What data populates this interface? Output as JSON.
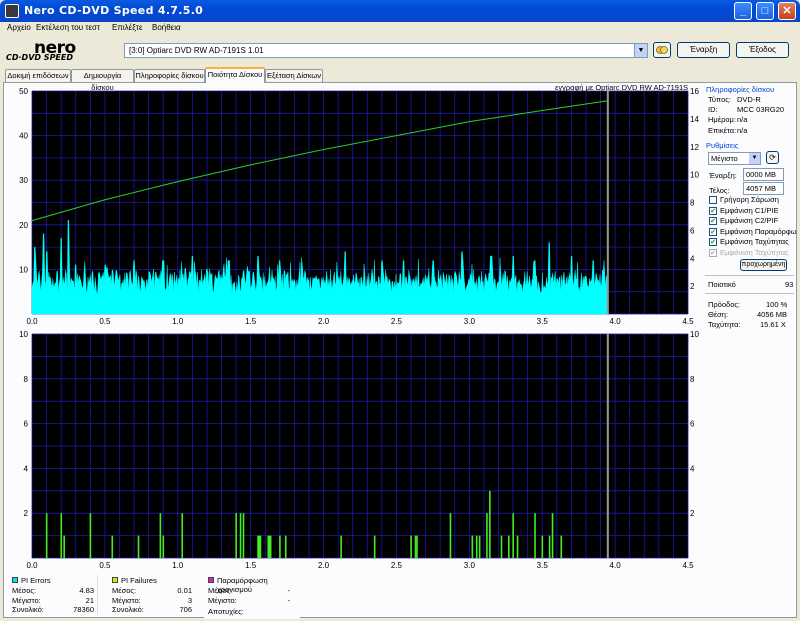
{
  "window": {
    "title": "Nero CD-DVD Speed 4.7.5.0",
    "minimize_symbol": "_",
    "maximize_symbol": "□",
    "close_symbol": "✕"
  },
  "menu": [
    "Αρχείο",
    "Εκτέλεση του τεστ",
    "Επιλέξτε",
    "Βοήθεια"
  ],
  "logo": {
    "brand": "nero",
    "product": "CD·DVD SPEED"
  },
  "drive": {
    "selected": "[3:0]   Optiarc DVD RW AD-7191S 1.01"
  },
  "toolbar": {
    "start_label": "Έναρξη",
    "exit_label": "Έξοδος"
  },
  "tabs": [
    {
      "label": "Δοκιμή επιδόσεων",
      "active": false
    },
    {
      "label": "Δημιουργία δίσκου",
      "active": false
    },
    {
      "label": "Πληροφορίες δίσκου",
      "active": false
    },
    {
      "label": "Ποιότητα Δίσκου",
      "active": true
    },
    {
      "label": "Εξέταση Δίσκων",
      "active": false
    }
  ],
  "top_chart_caption": "εγγραφή με Optiarc  DVD RW AD-7191S",
  "disc_info": {
    "title": "Πληροφορίες δίσκου",
    "type_label": "Τύπος:",
    "type_value": "DVD-R",
    "id_label": "ID:",
    "id_value": "MCC 03RG20",
    "date_label": "Ημέρομ:",
    "date_value": "n/a",
    "label_label": "Επικέτα:",
    "label_value": "n/a"
  },
  "settings": {
    "title": "Ρυθμίσεις",
    "speed_value": "Μέγιστο",
    "start_label": "Έναρξη:",
    "start_value": "0000 MB",
    "end_label": "Τέλος:",
    "end_value": "4057 MB",
    "checkboxes": [
      {
        "label": "Γρήγορη Σάρωση",
        "checked": false,
        "disabled": false
      },
      {
        "label": "Εμφάνιση C1/PIE",
        "checked": true,
        "disabled": false
      },
      {
        "label": "Εμφάνιση C2/PIF",
        "checked": true,
        "disabled": false
      },
      {
        "label": "Εμφάνιση Παραμόρφω",
        "checked": true,
        "disabled": false
      },
      {
        "label": "Εμφάνιση Ταχύτητας",
        "checked": true,
        "disabled": false
      },
      {
        "label": "Εμφάνιση Ταχύτητας",
        "checked": true,
        "disabled": true
      }
    ],
    "advanced_label": "προχωρημένη"
  },
  "quality": {
    "label": "Ποιοτικό",
    "value": "93"
  },
  "progress": {
    "progress_label": "Πρόοδος:",
    "progress_value": "100 %",
    "position_label": "Θέση:",
    "position_value": "4056 MB",
    "speed_label": "Ταχύτητα:",
    "speed_value": "15.61 X"
  },
  "legend": {
    "pi_errors": {
      "title": "PI Errors",
      "color": "#00e5ee",
      "avg_label": "Μέσος:",
      "avg": "4.83",
      "max_label": "Μέγιστο:",
      "max": "21",
      "total_label": "Συνολικό:",
      "total": "78360"
    },
    "pi_failures": {
      "title": "PI Failures",
      "color": "#d8e020",
      "avg_label": "Μέσος:",
      "avg": "0.01",
      "max_label": "Μέγιστο:",
      "max": "3",
      "total_label": "Συνολικό:",
      "total": "706"
    },
    "jitter": {
      "title": "Παραμόρφωση χρονισμού",
      "color": "#d020c8",
      "avg_label": "Μέσος:",
      "avg": "-",
      "max_label": "Μέγιστο:",
      "max": "-",
      "fail_label": "Αποτυχίες:",
      "fail": ""
    }
  },
  "chart_data": [
    {
      "type": "area",
      "x_ticks": [
        "0.0",
        "0.5",
        "1.0",
        "1.5",
        "2.0",
        "2.5",
        "3.0",
        "3.5",
        "4.0",
        "4.5"
      ],
      "xlim": [
        0,
        4.5
      ],
      "y_left_ticks": [
        "10",
        "20",
        "30",
        "40",
        "50"
      ],
      "ylim_left": [
        0,
        50
      ],
      "y_right_ticks": [
        "2",
        "4",
        "6",
        "8",
        "10",
        "12",
        "14",
        "16"
      ],
      "ylim_right": [
        0,
        16
      ],
      "grid": true,
      "background": "#000000",
      "end_marker_x": 3.95,
      "series": [
        {
          "role": "pi_errors",
          "color": "#00ffff",
          "base_level": 6,
          "spikes": [
            [
              0.02,
              15
            ],
            [
              0.08,
              18
            ],
            [
              0.1,
              14
            ],
            [
              0.2,
              17
            ],
            [
              0.25,
              21
            ],
            [
              0.3,
              11
            ],
            [
              0.5,
              11
            ],
            [
              0.7,
              12
            ],
            [
              0.9,
              12
            ],
            [
              1.1,
              13
            ],
            [
              1.35,
              12
            ],
            [
              1.55,
              13
            ],
            [
              1.7,
              12
            ],
            [
              1.85,
              11
            ],
            [
              2.15,
              14
            ],
            [
              2.4,
              12
            ],
            [
              2.55,
              12
            ],
            [
              2.75,
              12
            ],
            [
              2.95,
              14
            ],
            [
              3.15,
              13
            ],
            [
              3.3,
              13
            ],
            [
              3.45,
              12
            ],
            [
              3.55,
              16
            ],
            [
              3.7,
              13
            ],
            [
              3.85,
              12
            ]
          ]
        },
        {
          "role": "speed",
          "color": "#2ecc2e",
          "axis": "right",
          "x": [
            0.0,
            0.5,
            1.0,
            1.5,
            2.0,
            2.5,
            3.0,
            3.5,
            3.95
          ],
          "y": [
            6.7,
            8.2,
            9.5,
            10.7,
            11.8,
            12.8,
            13.8,
            14.6,
            15.3
          ]
        }
      ]
    },
    {
      "type": "bar",
      "x_ticks": [
        "0.0",
        "0.5",
        "1.0",
        "1.5",
        "2.0",
        "2.5",
        "3.0",
        "3.5",
        "4.0",
        "4.5"
      ],
      "xlim": [
        0,
        4.5
      ],
      "y_left_ticks": [
        "2",
        "4",
        "6",
        "8",
        "10"
      ],
      "ylim": [
        0,
        10
      ],
      "y_right_ticks": [
        "2",
        "4",
        "6",
        "8",
        "10"
      ],
      "grid": true,
      "background": "#000000",
      "end_marker_x": 3.95,
      "series": [
        {
          "role": "pi_failures",
          "color": "#44ee22",
          "x": [
            0.1,
            0.2,
            0.22,
            0.4,
            0.55,
            0.73,
            0.88,
            0.9,
            1.03,
            1.4,
            1.43,
            1.45,
            1.55,
            1.62,
            1.7,
            1.74,
            2.12,
            2.35,
            2.6,
            2.63,
            2.64,
            2.87,
            3.02,
            3.05,
            3.07,
            3.12,
            3.14,
            3.22,
            3.27,
            3.3,
            3.33,
            3.45,
            3.5,
            3.55,
            3.57,
            3.63
          ],
          "y": [
            2,
            2,
            1,
            2,
            1,
            1,
            2,
            1,
            2,
            2,
            2,
            2,
            1,
            1,
            1,
            1,
            1,
            1,
            1,
            1,
            1,
            2,
            1,
            1,
            1,
            2,
            3,
            1,
            1,
            2,
            1,
            2,
            1,
            1,
            2,
            1
          ]
        }
      ]
    }
  ]
}
